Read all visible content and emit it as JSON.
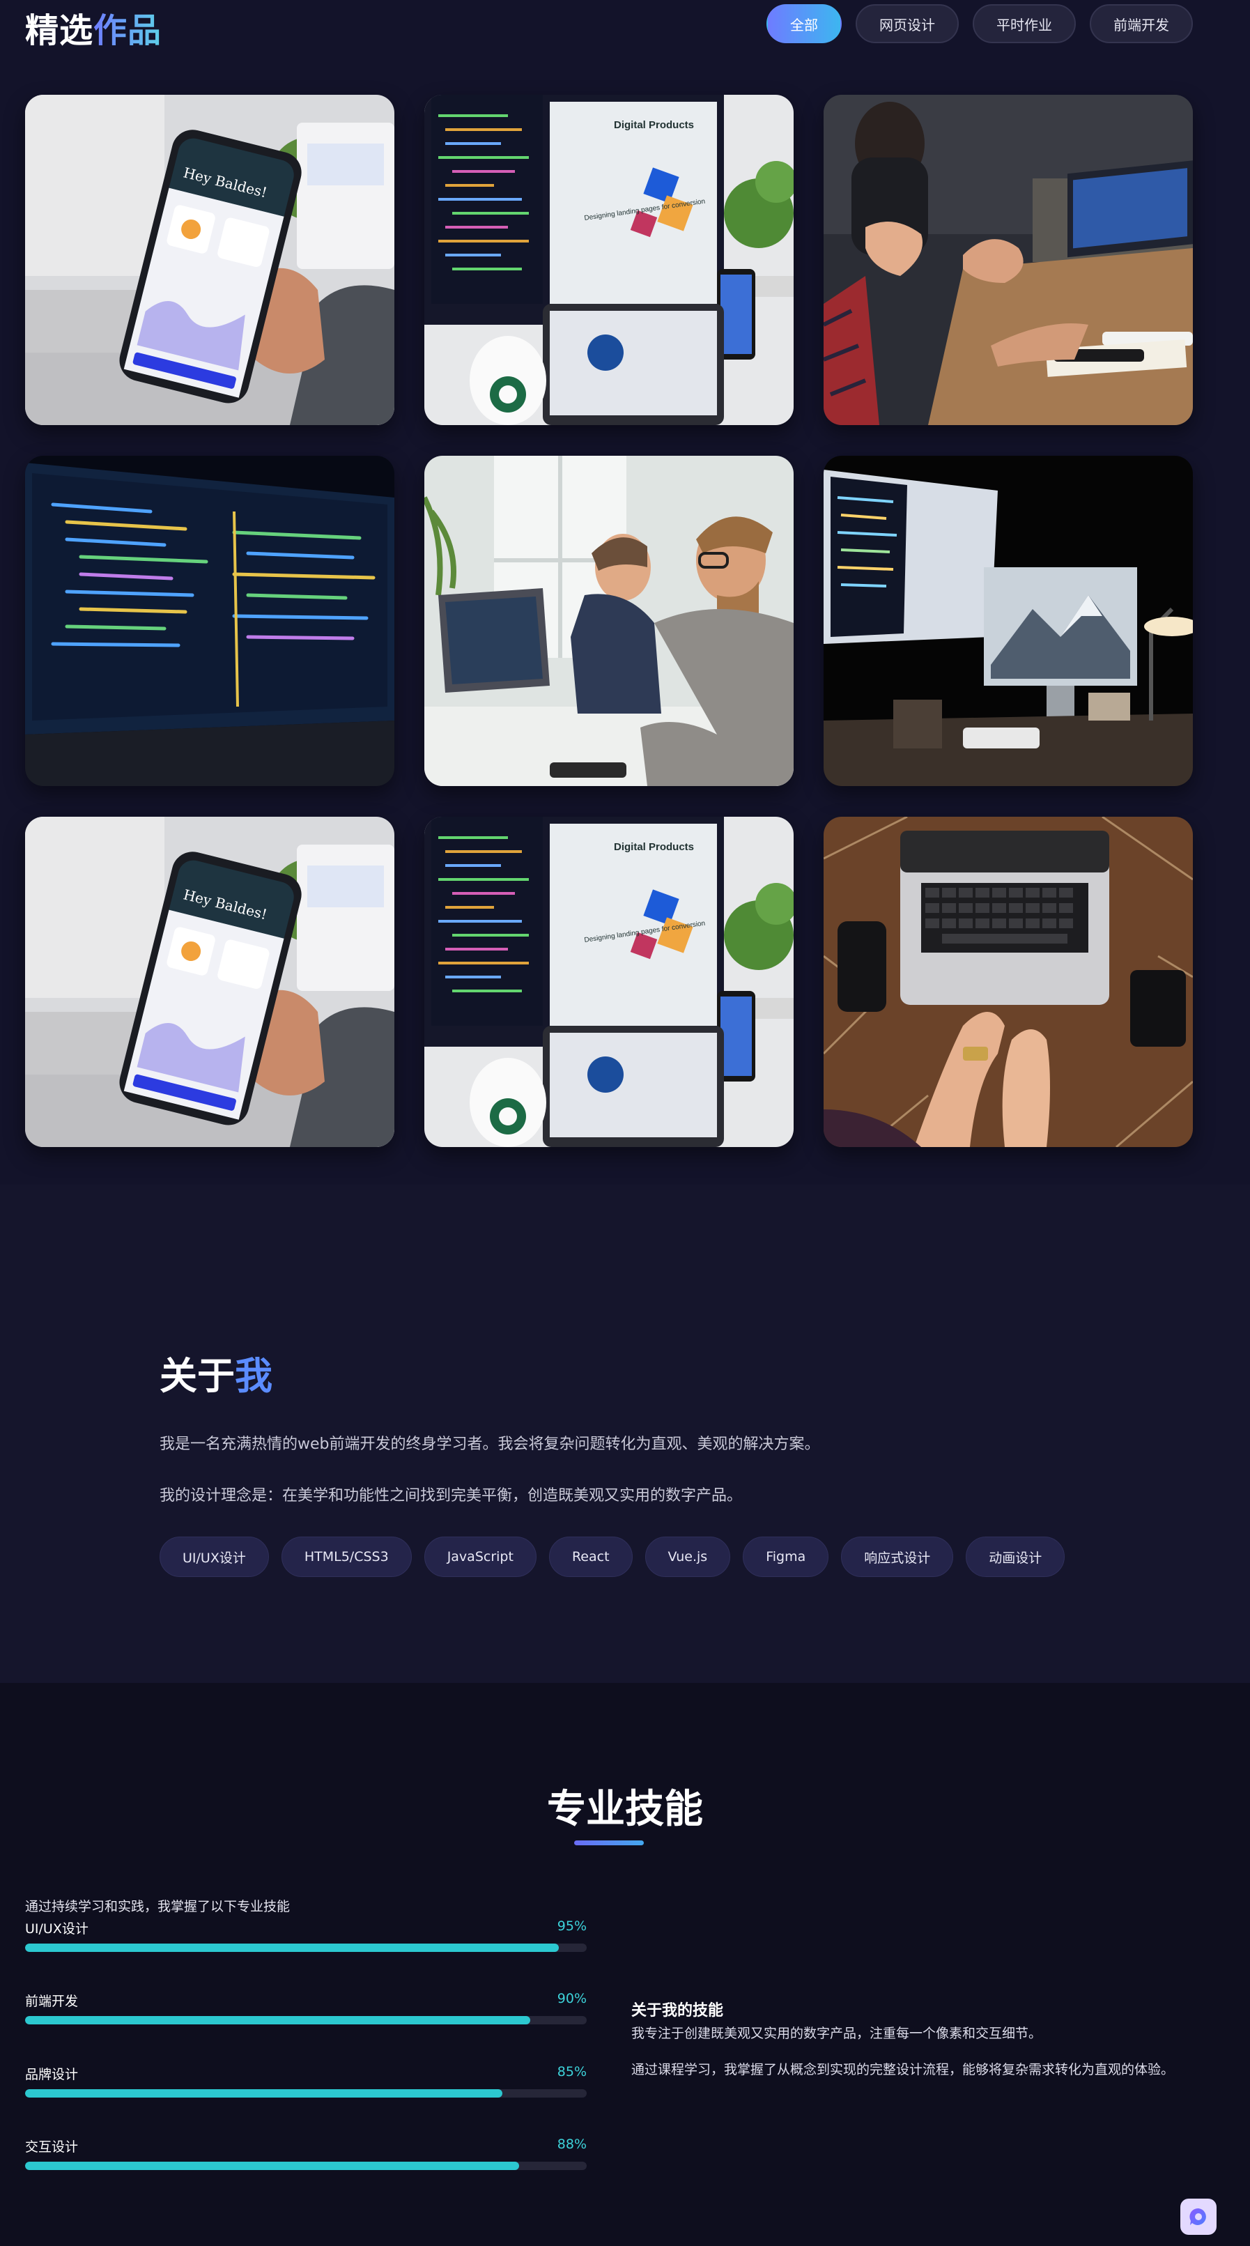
{
  "works": {
    "title_part1": "精选",
    "title_part2": "作品",
    "filters": [
      {
        "label": "全部",
        "active": true
      },
      {
        "label": "网页设计",
        "active": false
      },
      {
        "label": "平时作业",
        "active": false
      },
      {
        "label": "前端开发",
        "active": false
      }
    ],
    "items": [
      {
        "subject": "phone-dashboard-photo"
      },
      {
        "subject": "code-monitor-digital-products-photo"
      },
      {
        "subject": "team-meeting-laptop-photo"
      },
      {
        "subject": "laptop-code-closeup-photo"
      },
      {
        "subject": "men-working-at-desk-photo"
      },
      {
        "subject": "dark-desk-imac-photo"
      },
      {
        "subject": "phone-dashboard-photo"
      },
      {
        "subject": "code-monitor-digital-products-photo"
      },
      {
        "subject": "hands-typing-laptop-photo"
      }
    ],
    "photo_texts": {
      "phone_greeting": "Hey Baldes!",
      "monitor_heading": "Digital Products",
      "monitor_tagline": "Designing landing pages for conversion"
    }
  },
  "about": {
    "title_part1": "关于",
    "title_part2": "我",
    "paragraph1": "我是一名充满热情的web前端开发的终身学习者。我会将复杂问题转化为直观、美观的解决方案。",
    "paragraph2": "我的设计理念是：在美学和功能性之间找到完美平衡，创造既美观又实用的数字产品。",
    "tags": [
      "UI/UX设计",
      "HTML5/CSS3",
      "JavaScript",
      "React",
      "Vue.js",
      "Figma",
      "响应式设计",
      "动画设计"
    ]
  },
  "skills": {
    "title": "专业技能",
    "intro": "通过持续学习和实践，我掌握了以下专业技能",
    "items": [
      {
        "name": "UI/UX设计",
        "percent_label": "95%",
        "level": 0.95
      },
      {
        "name": "前端开发",
        "percent_label": "90%",
        "level": 0.9
      },
      {
        "name": "品牌设计",
        "percent_label": "85%",
        "level": 0.85
      },
      {
        "name": "交互设计",
        "percent_label": "88%",
        "level": 0.88
      }
    ],
    "side_title": "关于我的技能",
    "side_p1": "我专注于创建既美观又实用的数字产品，注重每一个像素和交互细节。",
    "side_p2": "通过课程学习，我掌握了从概念到实现的完整设计流程，能够将复杂需求转化为直观的体验。"
  },
  "colors": {
    "background": "#13132a",
    "accent_gradient_start": "#6e7cff",
    "accent_gradient_end": "#3db6f0",
    "skill_bar": "#2cc8d0"
  }
}
